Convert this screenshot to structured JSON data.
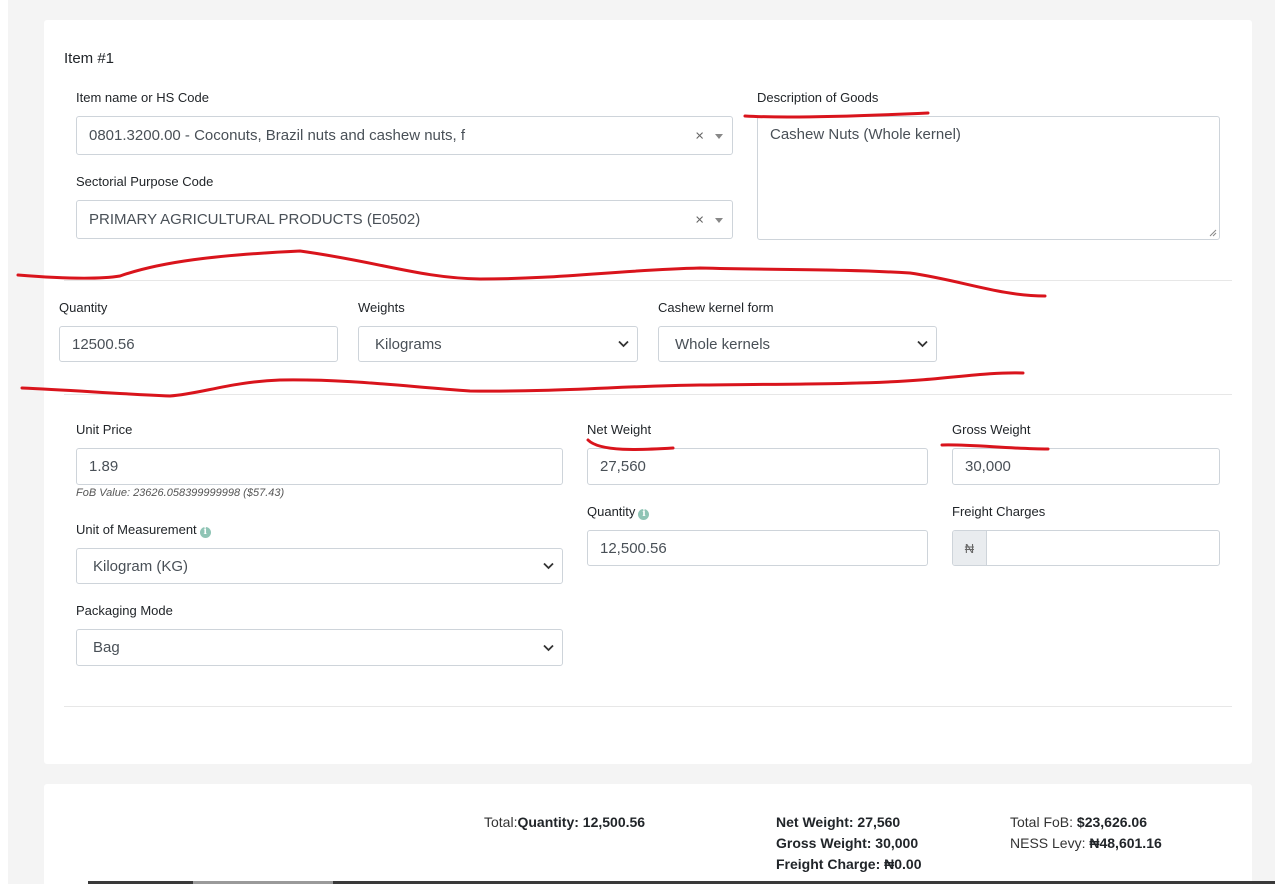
{
  "item": {
    "title": "Item #1",
    "hs_code": {
      "label": "Item name or HS Code",
      "value": "0801.3200.00 - Coconuts, Brazil nuts and cashew nuts, f",
      "clear": "×"
    },
    "description": {
      "label": "Description of Goods",
      "value": "Cashew Nuts (Whole kernel)"
    },
    "sector_code": {
      "label": "Sectorial Purpose Code",
      "value": "PRIMARY AGRICULTURAL PRODUCTS (E0502)",
      "clear": "×"
    },
    "quantity": {
      "label": "Quantity",
      "value": "12500.56"
    },
    "weights": {
      "label": "Weights",
      "value": "Kilograms"
    },
    "cashew_form": {
      "label": "Cashew kernel form",
      "value": "Whole kernels"
    },
    "unit_price": {
      "label": "Unit Price",
      "value": "1.89",
      "help": "FoB Value: 23626.058399999998 ($57.43)"
    },
    "net_weight": {
      "label": "Net Weight",
      "value": "27,560"
    },
    "gross_weight": {
      "label": "Gross Weight",
      "value": "30,000"
    },
    "quantity2": {
      "label": "Quantity",
      "value": "12,500.56"
    },
    "freight": {
      "label": "Freight Charges",
      "currency": "₦",
      "value": ""
    },
    "unit_measure": {
      "label": "Unit of Measurement",
      "value": "Kilogram (KG)"
    },
    "packaging": {
      "label": "Packaging Mode",
      "value": "Bag"
    }
  },
  "totals": {
    "total_prefix": "Total:",
    "quantity_label": "Quantity: 12,500.56",
    "net_weight": "Net Weight: 27,560",
    "gross_weight": "Gross Weight: 30,000",
    "freight_charge": "Freight Charge: ₦0.00",
    "fob_prefix": "Total FoB:",
    "fob_value": "$23,626.06",
    "ness_prefix": "NESS Levy:",
    "ness_value": "₦48,601.16"
  },
  "colors": {
    "annotation": "#d9141c",
    "border": "#ced4da",
    "addon_bg": "#e9ecef",
    "info_icon": "#8fc4b5"
  }
}
